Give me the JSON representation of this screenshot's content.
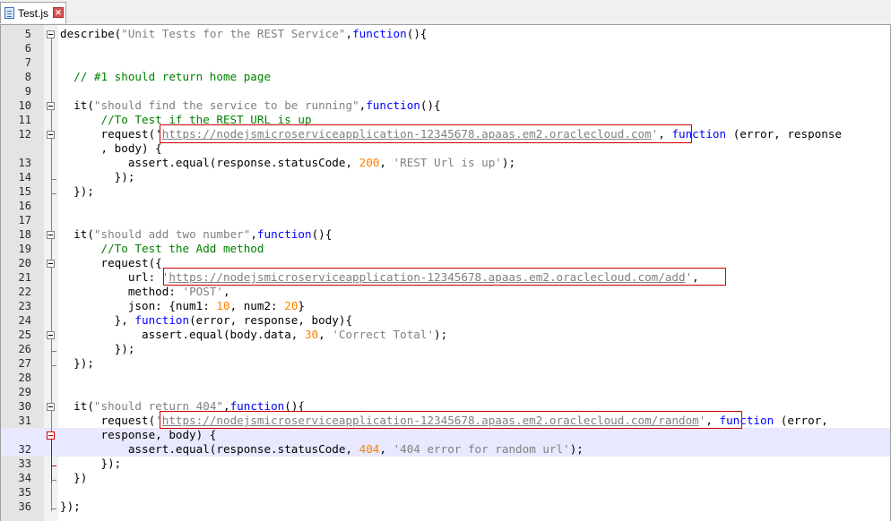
{
  "tab": {
    "label": "Test.js",
    "close_glyph": "✕"
  },
  "editor": {
    "lines": [
      {
        "num": "5",
        "tokens": [
          {
            "t": "describe("
          },
          {
            "t": "\"Unit Tests for the REST Service\"",
            "c": "str"
          },
          {
            "t": ","
          },
          {
            "t": "function",
            "c": "kw"
          },
          {
            "t": "(){"
          }
        ]
      },
      {
        "num": "6",
        "tokens": []
      },
      {
        "num": "7",
        "tokens": []
      },
      {
        "num": "8",
        "tokens": [
          {
            "t": "  // #1 should return home page",
            "c": "cm"
          }
        ]
      },
      {
        "num": "9",
        "tokens": []
      },
      {
        "num": "10",
        "tokens": [
          {
            "t": "  it("
          },
          {
            "t": "\"should find the service to be running\"",
            "c": "str"
          },
          {
            "t": ","
          },
          {
            "t": "function",
            "c": "kw"
          },
          {
            "t": "(){"
          }
        ]
      },
      {
        "num": "11",
        "tokens": [
          {
            "t": "      //To Test if the REST URL is up",
            "c": "cm"
          }
        ]
      },
      {
        "num": "12",
        "tokens": [
          {
            "t": "      request("
          },
          {
            "t": "'"
          },
          {
            "t": "https://nodejsmicroserviceapplication-12345678.apaas.em2.oraclecloud.com",
            "c": "url"
          },
          {
            "t": "'",
            "c": "str"
          },
          {
            "t": ", "
          },
          {
            "t": "function",
            "c": "kw"
          },
          {
            "t": " (error, response"
          }
        ]
      },
      {
        "num": "",
        "tokens": [
          {
            "t": "      , body) {"
          }
        ]
      },
      {
        "num": "13",
        "tokens": [
          {
            "t": "          assert.equal(response.statusCode, "
          },
          {
            "t": "200",
            "c": "num"
          },
          {
            "t": ", "
          },
          {
            "t": "'REST Url is up'",
            "c": "str"
          },
          {
            "t": ");"
          }
        ]
      },
      {
        "num": "14",
        "tokens": [
          {
            "t": "        });"
          }
        ]
      },
      {
        "num": "15",
        "tokens": [
          {
            "t": "  });"
          }
        ]
      },
      {
        "num": "16",
        "tokens": []
      },
      {
        "num": "17",
        "tokens": []
      },
      {
        "num": "18",
        "tokens": [
          {
            "t": "  it("
          },
          {
            "t": "\"should add two number\"",
            "c": "str"
          },
          {
            "t": ","
          },
          {
            "t": "function",
            "c": "kw"
          },
          {
            "t": "(){"
          }
        ]
      },
      {
        "num": "19",
        "tokens": [
          {
            "t": "      //To Test the Add method",
            "c": "cm"
          }
        ]
      },
      {
        "num": "20",
        "tokens": [
          {
            "t": "      request({"
          }
        ]
      },
      {
        "num": "21",
        "tokens": [
          {
            "t": "          url: "
          },
          {
            "t": "'",
            "c": "str"
          },
          {
            "t": "https://nodejsmicroserviceapplication-12345678.apaas.em2.oraclecloud.com/add",
            "c": "url"
          },
          {
            "t": "'",
            "c": "str"
          },
          {
            "t": ","
          }
        ]
      },
      {
        "num": "22",
        "tokens": [
          {
            "t": "          method: "
          },
          {
            "t": "'POST'",
            "c": "str"
          },
          {
            "t": ","
          }
        ]
      },
      {
        "num": "23",
        "tokens": [
          {
            "t": "          json: {num1: "
          },
          {
            "t": "10",
            "c": "num"
          },
          {
            "t": ", num2: "
          },
          {
            "t": "20",
            "c": "num"
          },
          {
            "t": "}"
          }
        ]
      },
      {
        "num": "24",
        "tokens": [
          {
            "t": "        }, "
          },
          {
            "t": "function",
            "c": "kw"
          },
          {
            "t": "(error, response, body){"
          }
        ]
      },
      {
        "num": "25",
        "tokens": [
          {
            "t": "            assert.equal(body.data, "
          },
          {
            "t": "30",
            "c": "num"
          },
          {
            "t": ", "
          },
          {
            "t": "'Correct Total'",
            "c": "str"
          },
          {
            "t": ");"
          }
        ]
      },
      {
        "num": "26",
        "tokens": [
          {
            "t": "        });"
          }
        ]
      },
      {
        "num": "27",
        "tokens": [
          {
            "t": "  });"
          }
        ]
      },
      {
        "num": "28",
        "tokens": []
      },
      {
        "num": "29",
        "tokens": []
      },
      {
        "num": "30",
        "tokens": [
          {
            "t": "  it("
          },
          {
            "t": "\"should return 404\"",
            "c": "str"
          },
          {
            "t": ","
          },
          {
            "t": "function",
            "c": "kw"
          },
          {
            "t": "(){"
          }
        ]
      },
      {
        "num": "31",
        "tokens": [
          {
            "t": "      request("
          },
          {
            "t": "'",
            "c": "str"
          },
          {
            "t": "https://nodejsmicroserviceapplication-12345678.apaas.em2.oraclecloud.com/random",
            "c": "url"
          },
          {
            "t": "'",
            "c": "str"
          },
          {
            "t": ", "
          },
          {
            "t": "function",
            "c": "kw"
          },
          {
            "t": " (error,"
          }
        ]
      },
      {
        "num": "",
        "tokens": [
          {
            "t": "      response, body) {"
          }
        ]
      },
      {
        "num": "32",
        "tokens": [
          {
            "t": "          assert.equal(response.statusCode, "
          },
          {
            "t": "404",
            "c": "num"
          },
          {
            "t": ", "
          },
          {
            "t": "'404 error for random url'",
            "c": "str"
          },
          {
            "t": ");"
          }
        ]
      },
      {
        "num": "33",
        "tokens": [
          {
            "t": "      });"
          }
        ]
      },
      {
        "num": "34",
        "tokens": [
          {
            "t": "  })"
          }
        ]
      },
      {
        "num": "35",
        "tokens": []
      },
      {
        "num": "36",
        "tokens": [
          {
            "t": "});"
          }
        ]
      }
    ]
  }
}
